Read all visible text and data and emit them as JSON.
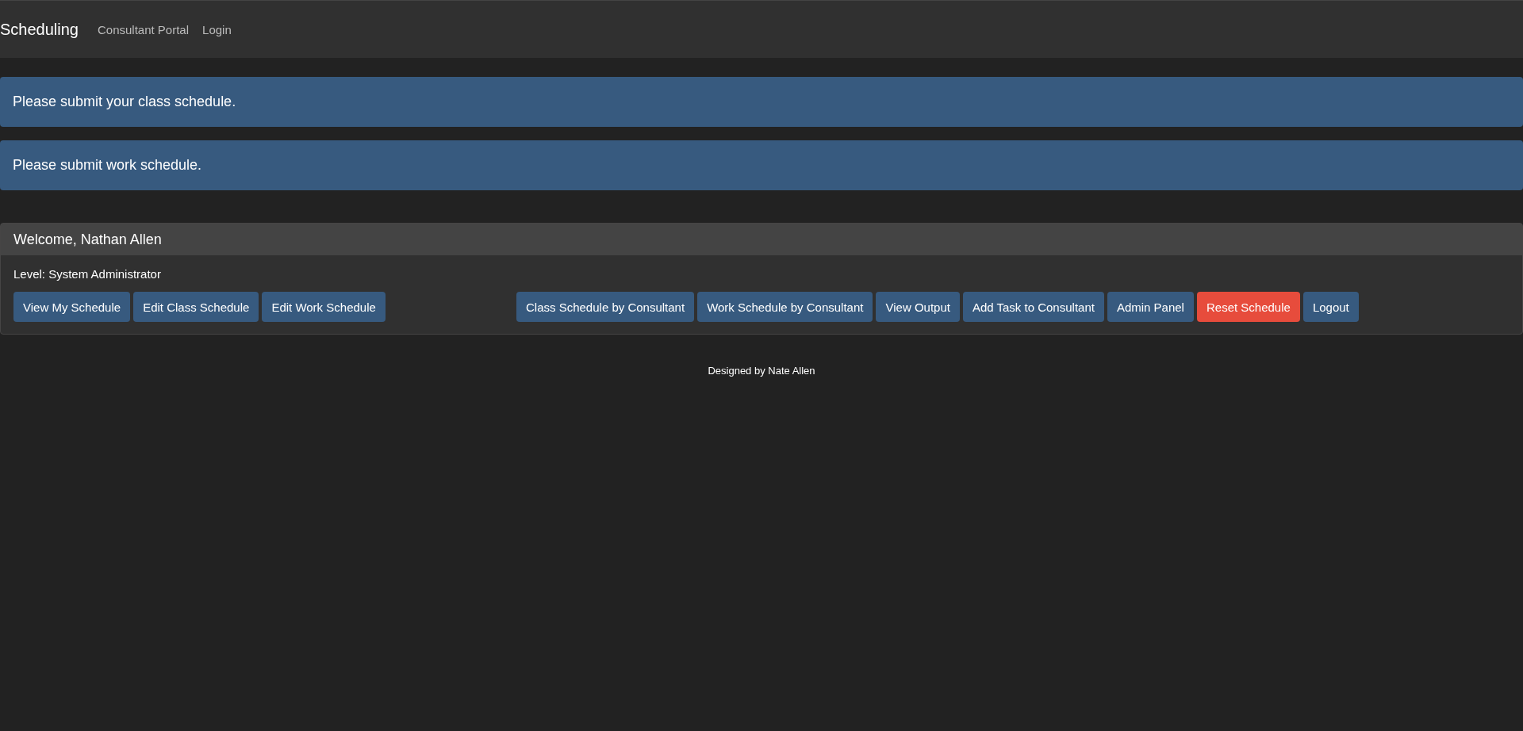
{
  "navbar": {
    "brand": "Scheduling",
    "links": [
      "Consultant Portal",
      "Login"
    ]
  },
  "alerts": [
    "Please submit your class schedule.",
    "Please submit work schedule."
  ],
  "panel": {
    "heading": "Welcome, Nathan Allen",
    "level_text": "Level: System Administrator",
    "left_buttons": [
      {
        "label": "View My Schedule",
        "kind": "primary"
      },
      {
        "label": "Edit Class Schedule",
        "kind": "primary"
      },
      {
        "label": "Edit Work Schedule",
        "kind": "primary"
      }
    ],
    "right_buttons": [
      {
        "label": "Class Schedule by Consultant",
        "kind": "primary"
      },
      {
        "label": "Work Schedule by Consultant",
        "kind": "primary"
      },
      {
        "label": "View Output",
        "kind": "primary"
      },
      {
        "label": "Add Task to Consultant",
        "kind": "primary"
      },
      {
        "label": "Admin Panel",
        "kind": "primary"
      },
      {
        "label": "Reset Schedule",
        "kind": "danger"
      },
      {
        "label": "Logout",
        "kind": "primary"
      }
    ]
  },
  "footer": "Designed by Nate Allen"
}
